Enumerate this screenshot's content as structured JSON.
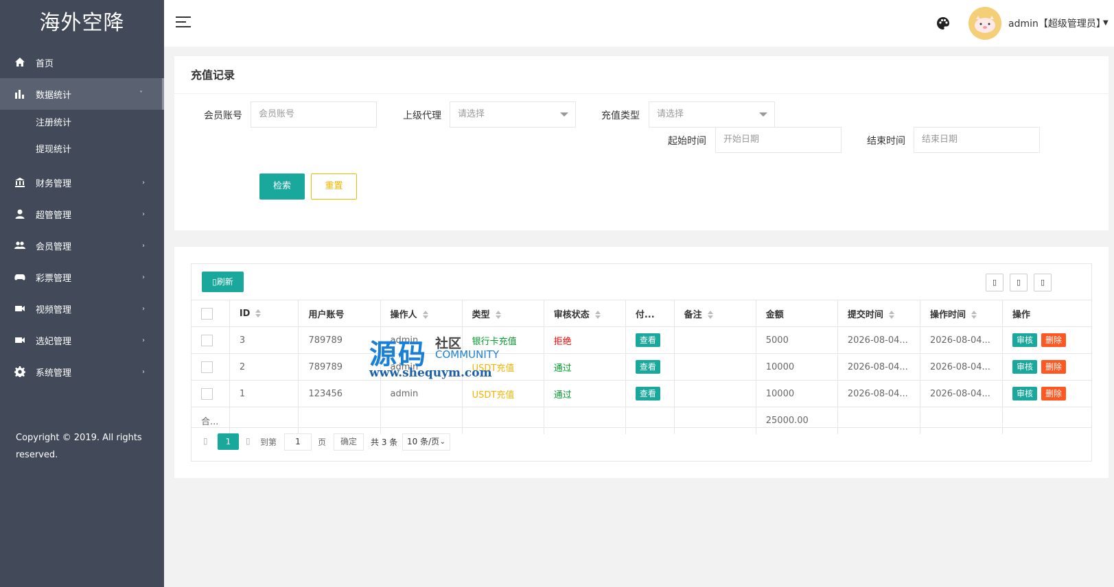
{
  "sidebar": {
    "logo": "海外空降",
    "items": [
      {
        "label": "首页",
        "icon": "home-icon"
      },
      {
        "label": "数据统计",
        "icon": "bar-chart-icon",
        "arrow": "˅",
        "children": [
          "注册统计",
          "提现统计"
        ]
      },
      {
        "label": "财务管理",
        "icon": "bank-icon",
        "arrow": "›"
      },
      {
        "label": "超管管理",
        "icon": "user-icon",
        "arrow": "›"
      },
      {
        "label": "会员管理",
        "icon": "users-icon",
        "arrow": "›"
      },
      {
        "label": "彩票管理",
        "icon": "gamepad-icon",
        "arrow": "›"
      },
      {
        "label": "视频管理",
        "icon": "video-icon",
        "arrow": "›"
      },
      {
        "label": "选妃管理",
        "icon": "video-icon",
        "arrow": "›"
      },
      {
        "label": "系统管理",
        "icon": "gear-icon",
        "arrow": "›"
      }
    ],
    "copyright": "Copyright © 2019. All rights reserved."
  },
  "header": {
    "user": "admin【超级管理员】"
  },
  "search": {
    "title": "充值记录",
    "member_label": "会员账号",
    "member_placeholder": "会员账号",
    "agent_label": "上级代理",
    "agent_value": "请选择",
    "type_label": "充值类型",
    "type_value": "请选择",
    "start_label": "起始时间",
    "start_placeholder": "开始日期",
    "end_label": "结束时间",
    "end_placeholder": "结束日期",
    "search_btn": "检索",
    "reset_btn": "重置"
  },
  "table": {
    "refresh": "刷新",
    "columns": [
      "ID",
      "用户账号",
      "操作人",
      "类型",
      "审核状态",
      "付...",
      "备注",
      "金额",
      "提交时间",
      "操作时间",
      "操作"
    ],
    "rows": [
      {
        "id": "3",
        "account": "789789",
        "operator": "admin",
        "type": "银行卡充值",
        "status": "拒绝",
        "pay": "查看",
        "note": "",
        "amount": "5000",
        "submit": "2026-08-04...",
        "op_time": "2026-08-04...",
        "audit": "审核",
        "delete": "删除"
      },
      {
        "id": "2",
        "account": "789789",
        "operator": "admin",
        "type": "USDT充值",
        "status": "通过",
        "pay": "查看",
        "note": "",
        "amount": "10000",
        "submit": "2026-08-04...",
        "op_time": "2026-08-04...",
        "audit": "审核",
        "delete": "删除"
      },
      {
        "id": "1",
        "account": "123456",
        "operator": "admin",
        "type": "USDT充值",
        "status": "通过",
        "pay": "查看",
        "note": "",
        "amount": "10000",
        "submit": "2026-08-04...",
        "op_time": "2026-08-04...",
        "audit": "审核",
        "delete": "删除"
      }
    ],
    "total_label": "合...",
    "total_amount": "25000.00"
  },
  "pager": {
    "current": "1",
    "goto": "到第",
    "input": "1",
    "page": "页",
    "ok": "确定",
    "total": "共 3 条",
    "size": "10 条/页"
  },
  "watermark": {
    "main": "源码",
    "sub": "社区",
    "en": "COMMUNITY",
    "url": "www.shequym.com"
  }
}
